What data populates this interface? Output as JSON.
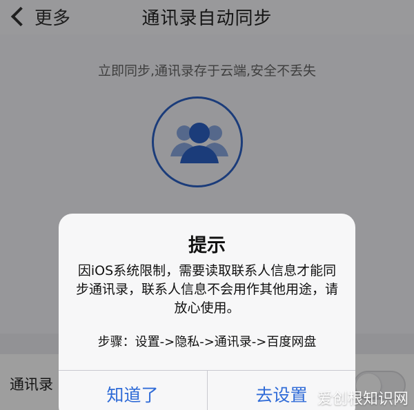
{
  "nav": {
    "back_label": "更多",
    "title": "通讯录自动同步"
  },
  "main": {
    "subtitle": "立即同步,通讯录存于云端,安全不丢失",
    "icon": "contacts-icon"
  },
  "settings_row": {
    "label": "通讯录",
    "toggle_on": false
  },
  "dialog": {
    "title": "提示",
    "message": "因iOS系统限制，需要读取联系人信息才能同步通讯录，联系人信息不会用作其他用途，请放心使用。",
    "steps": "步骤：设置->隐私->通讯录->百度网盘",
    "button_cancel": "知道了",
    "button_settings": "去设置"
  },
  "watermark": "爱创根知识网",
  "colors": {
    "accent": "#2f6bd7",
    "icon_blue": "#2c62c6",
    "overlay": "#00000061"
  }
}
